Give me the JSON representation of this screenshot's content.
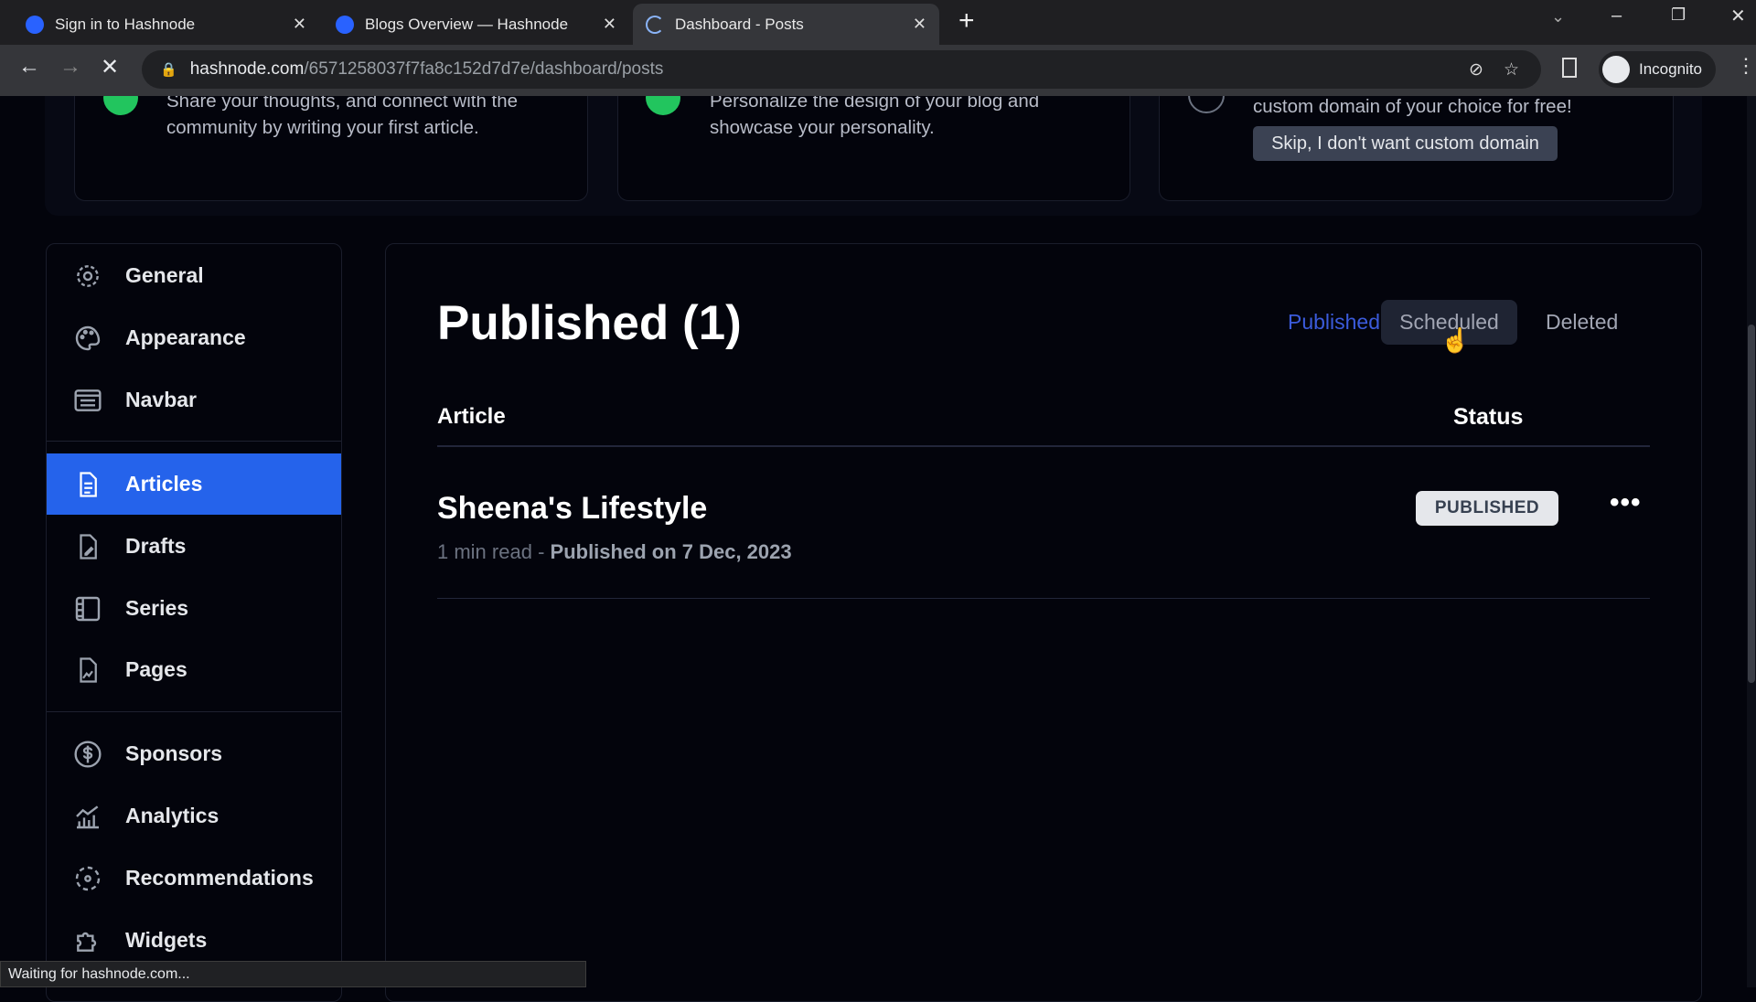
{
  "browser": {
    "tabs": [
      {
        "title": "Sign in to Hashnode"
      },
      {
        "title": "Blogs Overview — Hashnode"
      },
      {
        "title": "Dashboard - Posts",
        "active": true
      }
    ],
    "url_domain": "hashnode.com",
    "url_path": "/6571258037f7fa8c152d7d7e/dashboard/posts",
    "profile": "Incognito",
    "status": "Waiting for hashnode.com..."
  },
  "onboarding": {
    "cards": [
      {
        "text": "Share your thoughts, and connect with the community by writing your first article.",
        "done": true
      },
      {
        "text": "Personalize the design of your blog and showcase your personality.",
        "done": true
      },
      {
        "text": "custom domain of your choice for free!",
        "done": false,
        "button": "Skip, I don't want custom domain"
      }
    ]
  },
  "sidebar": {
    "items": [
      {
        "label": "General",
        "icon": "gear-icon"
      },
      {
        "label": "Appearance",
        "icon": "palette-icon"
      },
      {
        "label": "Navbar",
        "icon": "navbar-icon"
      },
      {
        "label": "Articles",
        "icon": "document-icon",
        "active": true
      },
      {
        "label": "Drafts",
        "icon": "draft-icon"
      },
      {
        "label": "Series",
        "icon": "series-icon"
      },
      {
        "label": "Pages",
        "icon": "pages-icon"
      },
      {
        "label": "Sponsors",
        "icon": "dollar-icon"
      },
      {
        "label": "Analytics",
        "icon": "chart-icon"
      },
      {
        "label": "Recommendations",
        "icon": "recommendations-icon"
      },
      {
        "label": "Widgets",
        "icon": "puzzle-icon"
      }
    ]
  },
  "main": {
    "title": "Published (1)",
    "filters": [
      {
        "label": "Published",
        "active": true
      },
      {
        "label": "Scheduled",
        "hover": true
      },
      {
        "label": "Deleted"
      }
    ],
    "columns": {
      "article": "Article",
      "status": "Status"
    },
    "rows": [
      {
        "title": "Sheena's Lifestyle",
        "read": "1 min read",
        "sep": " - ",
        "published": "Published on 7 Dec, 2023",
        "status": "PUBLISHED"
      }
    ]
  },
  "colors": {
    "accent": "#2563eb",
    "active_filter": "#3b5bdb",
    "success": "#22c55e"
  }
}
